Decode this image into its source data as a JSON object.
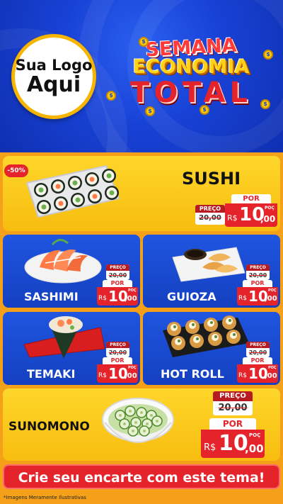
{
  "header": {
    "logo_line1": "Sua Logo",
    "logo_line2": "Aqui",
    "title_word1": "SEMANA",
    "title_word2": "ECONOMIA",
    "title_word3": "TOTAL"
  },
  "colors": {
    "brand_blue": "#1842d6",
    "brand_yellow": "#ffd62a",
    "price_red": "#e5232a",
    "orange_bg": "#f4a018"
  },
  "featured": {
    "name": "SUSHI",
    "discount": "-50%",
    "old_label": "PREÇO",
    "old_price": "20,00",
    "new_label": "POR",
    "currency": "R$",
    "new_price_int": "10",
    "new_price_dec": ",00",
    "unit": "POÇ",
    "icon": "sushi-tray-icon"
  },
  "products": [
    {
      "name": "SASHIMI",
      "old_label": "PREÇO",
      "old_price": "20,00",
      "new_label": "POR",
      "currency": "R$",
      "new_price_int": "10",
      "new_price_dec": ",00",
      "unit": "POÇ",
      "icon": "sashimi-plate-icon"
    },
    {
      "name": "GUIOZA",
      "old_label": "PREÇO",
      "old_price": "20,00",
      "new_label": "POR",
      "currency": "R$",
      "new_price_int": "10",
      "new_price_dec": ",00",
      "unit": "POÇ",
      "icon": "gyoza-plate-icon"
    },
    {
      "name": "TEMAKI",
      "old_label": "PREÇO",
      "old_price": "20,00",
      "new_label": "POR",
      "currency": "R$",
      "new_price_int": "10",
      "new_price_dec": ",00",
      "unit": "POÇ",
      "icon": "temaki-cone-icon"
    },
    {
      "name": "HOT ROLL",
      "old_label": "PREÇO",
      "old_price": "20,00",
      "new_label": "POR",
      "currency": "R$",
      "new_price_int": "10",
      "new_price_dec": ",00",
      "unit": "POÇ",
      "icon": "hot-roll-tray-icon"
    }
  ],
  "bottom": {
    "name": "SUNOMONO",
    "old_label": "PREÇO",
    "old_price": "20,00",
    "new_label": "POR",
    "currency": "R$",
    "new_price_int": "10",
    "new_price_dec": ",00",
    "unit": "POÇ",
    "icon": "sunomono-bowl-icon"
  },
  "cta": "Crie seu encarte com este tema!",
  "footnote": "*Imagens Meramente Ilustrativas"
}
